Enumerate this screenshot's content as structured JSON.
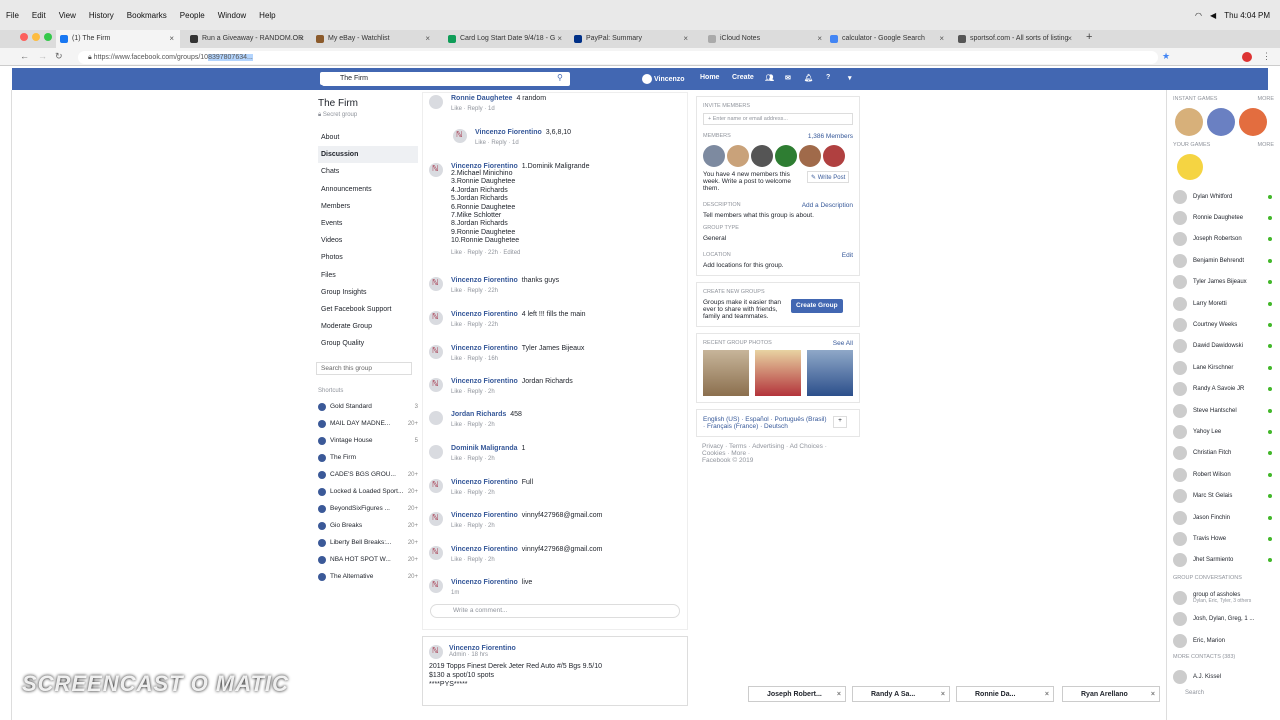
{
  "mac_menu": [
    "File",
    "Edit",
    "View",
    "History",
    "Bookmarks",
    "People",
    "Window",
    "Help"
  ],
  "mac_time": "Thu 4:04 PM",
  "tabs": [
    {
      "label": "(1) The Firm",
      "color": "#1877f2"
    },
    {
      "label": "Run a Giveaway - RANDOM.OR",
      "color": "#333"
    },
    {
      "label": "My eBay - Watchlist",
      "color": "#8b5a2b"
    },
    {
      "label": "Card Log Start Date 9/4/18 - G",
      "color": "#0f9d58"
    },
    {
      "label": "PayPal: Summary",
      "color": "#003087"
    },
    {
      "label": "iCloud Notes",
      "color": "#aaa"
    },
    {
      "label": "calculator - Google Search",
      "color": "#4285f4"
    },
    {
      "label": "sportsof.com - All sorts of listing",
      "color": "#555"
    }
  ],
  "url": {
    "prefix": "https://www.facebook.com/groups/10",
    "selected": "8397807634..."
  },
  "fb": {
    "search_value": "The Firm",
    "user": "Vincenzo",
    "home": "Home",
    "create": "Create"
  },
  "group": {
    "title": "The Firm",
    "privacy": "Secret group"
  },
  "left_nav": [
    "About",
    "Discussion",
    "Chats",
    "Announcements",
    "Members",
    "Events",
    "Videos",
    "Photos",
    "Files",
    "Group Insights",
    "Get Facebook Support",
    "Moderate Group",
    "Group Quality"
  ],
  "left_search": "Search this group",
  "shortcuts_header": "Shortcuts",
  "shortcuts": [
    {
      "name": "Gold Standard",
      "count": "3"
    },
    {
      "name": "MAIL DAY MADNE...",
      "count": "20+"
    },
    {
      "name": "Vintage House",
      "count": "5"
    },
    {
      "name": "The Firm",
      "count": ""
    },
    {
      "name": "CADE'S BGS GROU...",
      "count": "20+"
    },
    {
      "name": "Locked & Loaded Sport...",
      "count": "20+"
    },
    {
      "name": "BeyondSixFigures ...",
      "count": "20+"
    },
    {
      "name": "Gio Breaks",
      "count": "20+"
    },
    {
      "name": "Liberty Bell Breaks:...",
      "count": "20+"
    },
    {
      "name": "NBA HOT SPOT W...",
      "count": "20+"
    },
    {
      "name": "The Alternative",
      "count": "20+"
    }
  ],
  "comments": [
    {
      "name": "Ronnie Daughetee",
      "text": "4 random",
      "meta": "Like · Reply · 1d"
    },
    {
      "name": "Vincenzo Fiorentino",
      "text": "3,6,8,10",
      "meta": "Like · Reply · 1d"
    },
    {
      "name": "Vincenzo Fiorentino",
      "text": "1.Dominik Maligrande",
      "list": [
        "2.Michael Minichino",
        "3.Ronnie Daughetee",
        "4.Jordan Richards",
        "5.Jordan Richards",
        "6.Ronnie Daughetee",
        "7.Mike Schlotter",
        "8.Jordan Richards",
        "9.Ronnie Daughetee",
        "10.Ronnie Daughetee"
      ],
      "meta": "Like · Reply · 22h · Edited"
    },
    {
      "name": "Vincenzo Fiorentino",
      "text": "thanks guys",
      "meta": "Like · Reply · 22h"
    },
    {
      "name": "Vincenzo Fiorentino",
      "text": "4 left !!! fills the main",
      "meta": "Like · Reply · 22h"
    },
    {
      "name": "Vincenzo Fiorentino",
      "text": "Tyler James Bijeaux",
      "meta": "Like · Reply · 16h"
    },
    {
      "name": "Vincenzo Fiorentino",
      "text": "Jordan Richards",
      "meta": "Like · Reply · 2h"
    },
    {
      "name": "Jordan Richards",
      "text": "458",
      "meta": "Like · Reply · 2h"
    },
    {
      "name": "Dominik Maligranda",
      "text": "1",
      "meta": "Like · Reply · 2h"
    },
    {
      "name": "Vincenzo Fiorentino",
      "text": "Full",
      "meta": "Like · Reply · 2h"
    },
    {
      "name": "Vincenzo Fiorentino",
      "text": "vinnyf427968@gmail.com",
      "meta": "Like · Reply · 2h"
    },
    {
      "name": "Vincenzo Fiorentino",
      "text": "vinnyf427968@gmail.com",
      "meta": "Like · Reply · 2h"
    },
    {
      "name": "Vincenzo Fiorentino",
      "text": "live",
      "meta": "1m"
    }
  ],
  "write_comment": "Write a comment...",
  "post": {
    "author": "Vincenzo Fiorentino",
    "role": "Admin · 18 hrs",
    "line1": "2019 Topps Finest Derek Jeter Red Auto #/5 Bgs 9.5/10",
    "line2": "$130 a spot/10 spots",
    "line3": "****PYS*****"
  },
  "right": {
    "invite_h": "Invite Members",
    "invite_ph": "+ Enter name or email address...",
    "members_h": "Members",
    "members_count": "1,386 Members",
    "new_members": "You have 4 new members this week. Write a post to welcome them.",
    "write_post": "Write Post",
    "desc_h": "Description",
    "add_desc": "Add a Description",
    "desc_text": "Tell members what this group is about.",
    "type_h": "Group Type",
    "type_val": "General",
    "loc_h": "Location",
    "loc_edit": "Edit",
    "loc_text": "Add locations for this group.",
    "create_h": "Create New Groups",
    "create_text": "Groups make it easier than ever to share with friends, family and teammates.",
    "create_btn": "Create Group",
    "photos_h": "Recent Group Photos",
    "see_all": "See All",
    "langs": "English (US) · Español · Português (Brasil) · Français (France) · Deutsch",
    "footer": "Privacy · Terms · Advertising · Ad Choices · Cookies · More ·",
    "copyright": "Facebook © 2019"
  },
  "rail": {
    "instant": "Instant Games",
    "more": "More",
    "your_games": "Your Games",
    "contacts": [
      "Dylan Whitford",
      "Ronnie Daughetee",
      "Joseph Robertson",
      "Benjamin Behrendt",
      "Tyler James Bijeaux",
      "Larry Moretti",
      "Courtney Weeks",
      "Dawid Dawidowski",
      "Lane Kirschner",
      "Randy A Savoie JR",
      "Steve Hantschel",
      "Yahoy Lee",
      "Christian Fitch",
      "Robert Wilson",
      "Marc St Gelais",
      "Jason Finchin",
      "Travis Howe",
      "Jhet Sarmiento"
    ],
    "group_conv_h": "Group Conversations",
    "group_conv": [
      {
        "name": "group of assholes",
        "sub": "Dylan, Eric, Tyler, 3 others"
      },
      {
        "name": "Josh, Dylan, Greg, 1 ...",
        "sub": ""
      },
      {
        "name": "Eric, Marion",
        "sub": ""
      }
    ],
    "more_contacts": "More Contacts (383)",
    "last": "A.J. Kissel",
    "search": "Search"
  },
  "chats": [
    "Joseph Robert...",
    "Randy A Sa...",
    "Ronnie Da...",
    "Ryan Arellano"
  ],
  "watermark": {
    "small": "Recorded with",
    "big": "SCREENCAST O MATIC"
  }
}
